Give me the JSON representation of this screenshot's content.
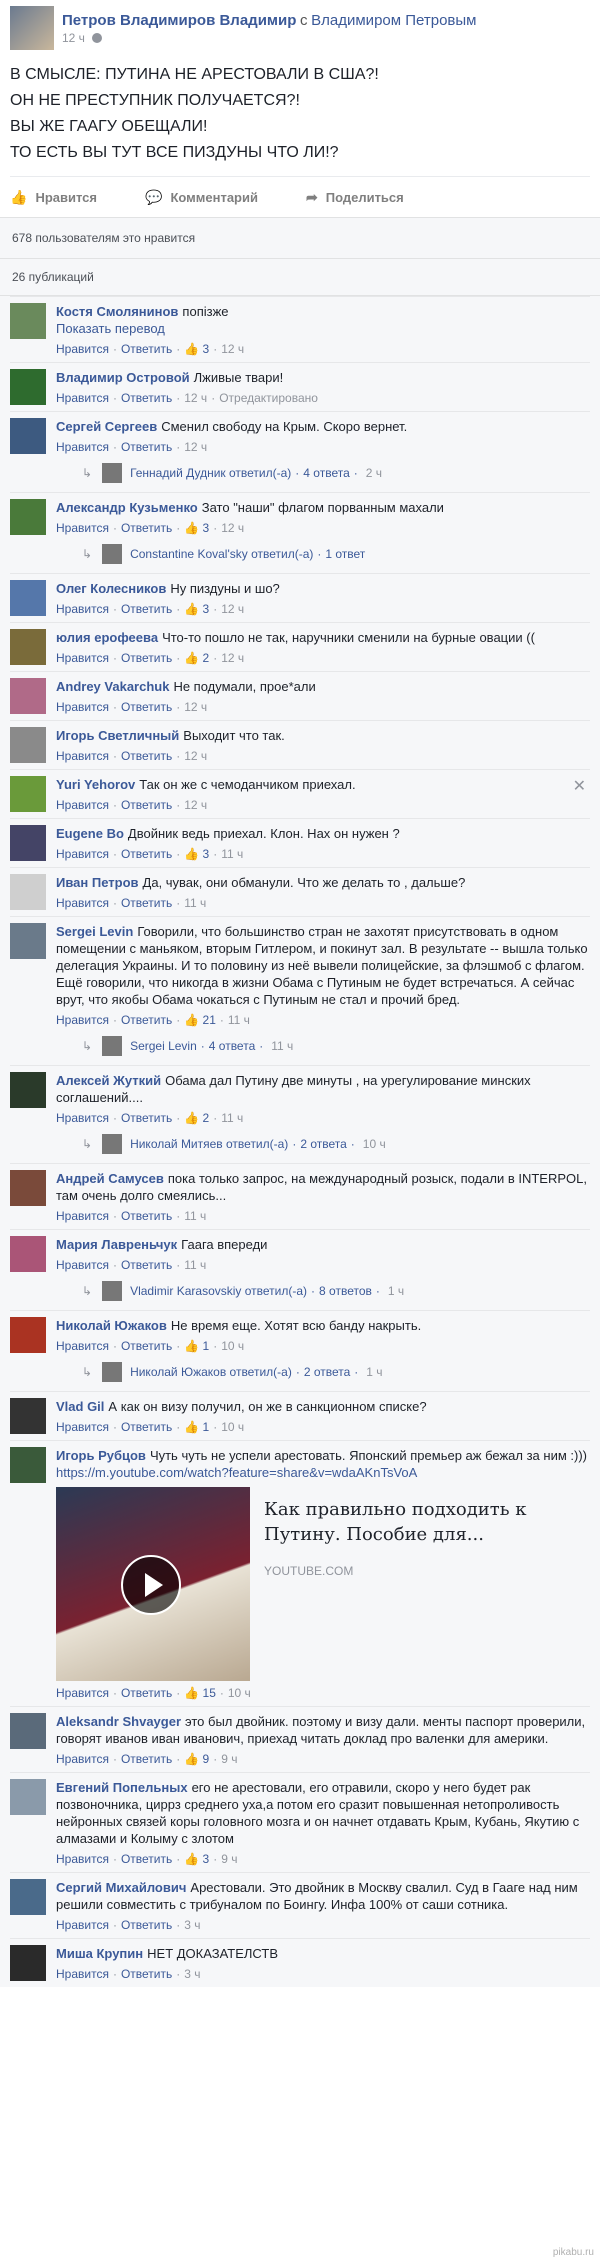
{
  "post": {
    "author": "Петров Владимиров Владимир",
    "with_word": "с",
    "with_name": "Владимиром Петровым",
    "time": "12 ч",
    "lines": [
      "В СМЫСЛЕ: ПУТИНА НЕ АРЕСТОВАЛИ В США?!",
      "ОН НЕ ПРЕСТУПНИК ПОЛУЧАЕТСЯ?!",
      "ВЫ ЖЕ ГААГУ ОБЕЩАЛИ!",
      "ТО ЕСТЬ ВЫ ТУТ ВСЕ ПИЗДУНЫ ЧТО ЛИ!?"
    ],
    "actions": {
      "like": "Нравится",
      "comment": "Комментарий",
      "share": "Поделиться"
    }
  },
  "likes_line": "678 пользователям это нравится",
  "shares_line": "26 публикаций",
  "meta_labels": {
    "like": "Нравится",
    "reply": "Ответить",
    "edited": "Отредактировано",
    "replied": "ответил(-а)"
  },
  "comments": [
    {
      "name": "Костя Смолянинов",
      "text": "попізже",
      "translate": "Показать перевод",
      "likes": "3",
      "time": "12 ч",
      "av": "#6a8a5c"
    },
    {
      "name": "Владимир Островой",
      "text": "Лживые твари!",
      "likes": "",
      "time": "12 ч",
      "edited": true,
      "av": "#2e6b2e"
    },
    {
      "name": "Сергей Сергеев",
      "text": "Сменил свободу на Крым. Скоро вернет.",
      "likes": "",
      "time": "12 ч",
      "av": "#3d5a80",
      "reply": {
        "name": "Геннадий Дудник",
        "count": "4 ответа",
        "time": "2 ч"
      }
    },
    {
      "name": "Александр Кузьменко",
      "text": "Зато \"наши\" флагом порванным махали",
      "likes": "3",
      "time": "12 ч",
      "av": "#4a7a3a",
      "reply": {
        "name": "Constantine Koval'sky",
        "count": "1 ответ",
        "time": ""
      }
    },
    {
      "name": "Олег Колесников",
      "text": "Ну пиздуны и шо?",
      "likes": "3",
      "time": "12 ч",
      "av": "#5577aa"
    },
    {
      "name": "юлия ерофеева",
      "text": "Что-то пошло не так, наручники сменили на бурные овации ((",
      "likes": "2",
      "time": "12 ч",
      "av": "#7a6b3a"
    },
    {
      "name": "Andrey Vakarchuk",
      "text": "Не подумали, прое*али",
      "likes": "",
      "time": "12 ч",
      "av": "#b06a88"
    },
    {
      "name": "Игорь Светличный",
      "text": "Выходит что так.",
      "likes": "",
      "time": "12 ч",
      "av": "#8a8a8a"
    },
    {
      "name": "Yuri Yehorov",
      "text": "Так он же с чемоданчиком приехал.",
      "likes": "",
      "time": "12 ч",
      "av": "#6a9a3a",
      "x": true
    },
    {
      "name": "Eugene Bo",
      "text": "Двойник ведь приехал. Клон. Нах он нужен ?",
      "likes": "3",
      "time": "11 ч",
      "av": "#444466"
    },
    {
      "name": "Иван Петров",
      "text": "Да, чувак, они обманули. Что же делать то , дальше?",
      "likes": "",
      "time": "11 ч",
      "av": "#cfcfcf"
    },
    {
      "name": "Sergei Levin",
      "text": "Говорили, что большинство стран не захотят присутствовать в одном помещении с маньяком, вторым Гитлером, и покинут зал. В результате -- вышла только делегация Украины. И то половину из неё вывели полицейские, за флэшмоб с флагом. Ещё говорили, что никогда в жизни Обама с Путиным не будет встречаться. А сейчас врут, что якобы Обама чокаться с Путиным не стал и прочий бред.",
      "likes": "21",
      "time": "11 ч",
      "av": "#6a7a8a",
      "reply": {
        "name": "Sergei Levin",
        "count": "4 ответа",
        "time": "11 ч",
        "nophrase": true
      }
    },
    {
      "name": "Алексей Жуткий",
      "text": "Обама дал Путину две минуты , на урегулирование минских соглашений....",
      "likes": "2",
      "time": "11 ч",
      "av": "#2a3a2a",
      "reply": {
        "name": "Николай Митяев",
        "count": "2 ответа",
        "time": "10 ч"
      }
    },
    {
      "name": "Андрей Самусев",
      "text": "пока только запрос, на международный розыск, подали в INTERPOL, там очень долго смеялись...",
      "likes": "",
      "time": "11 ч",
      "av": "#7a4a3a"
    },
    {
      "name": "Мария Лавреньчук",
      "text": "Гаага впереди",
      "likes": "",
      "time": "11 ч",
      "av": "#aa5577",
      "reply": {
        "name": "Vladimir Karasovskiy",
        "count": "8 ответов",
        "time": "1 ч"
      }
    },
    {
      "name": "Николай Южаков",
      "text": "Не время еще. Хотят всю банду накрыть.",
      "likes": "1",
      "time": "10 ч",
      "av": "#aa3322",
      "reply": {
        "name": "Николай Южаков",
        "count": "2 ответа",
        "time": "1 ч"
      }
    },
    {
      "name": "Vlad Gil",
      "text": "А как он визу получил, он же в санкционном списке?",
      "likes": "1",
      "time": "10 ч",
      "av": "#333333"
    },
    {
      "name": "Игорь Рубцов",
      "text": "Чуть чуть не успели арестовать. Японский премьер аж бежал за ним :)))",
      "link": "https://m.youtube.com/watch?feature=share&v=wdaAKnTsVoA",
      "card": {
        "title": "Как правильно подходить к Путину. Пособие для...",
        "source": "YOUTUBE.COM"
      },
      "likes": "15",
      "time": "10 ч",
      "av": "#3a5a3a"
    },
    {
      "name": "Aleksandr Shvayger",
      "text": "это был двойник. поэтому и визу дали. менты паспорт проверили, говорят иванов иван иванович, приехад читать доклад про валенки для америки.",
      "likes": "9",
      "time": "9 ч",
      "av": "#5a6a7a"
    },
    {
      "name": "Евгений Попельных",
      "text": "его не арестовали, его отравили, скоро у него будет рак позвоночника, циррз среднего уха,а потом его сразит повышенная нетопроливость нейронных связей коры головного мозга и он начнет отдавать Крым, Кубань, Якутию с алмазами и Колыму с злотом",
      "likes": "3",
      "time": "9 ч",
      "av": "#8a9aaa"
    },
    {
      "name": "Сергий Михайлович",
      "text": "Арестовали. Это двойник в Москву свалил. Суд в Гааге над ним решили совместить с трибуналом по Боингу. Инфа 100% от саши сотника.",
      "likes": "",
      "time": "3 ч",
      "av": "#4a6a8a"
    },
    {
      "name": "Миша Крупин",
      "text": "НЕТ ДОКАЗАТЕЛСТВ",
      "likes": "",
      "time": "3 ч",
      "av": "#2a2a2a"
    }
  ],
  "watermark": "pikabu.ru"
}
